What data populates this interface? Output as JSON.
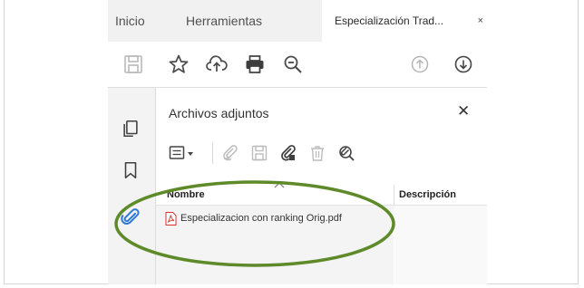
{
  "tabs": [
    {
      "label": "Inicio"
    },
    {
      "label": "Herramientas"
    },
    {
      "label": "Especialización Trad..."
    }
  ],
  "tab_close_symbol": "×",
  "toolbar": {
    "icons": [
      "save-icon",
      "bookmark-star-icon",
      "upload-cloud-icon",
      "print-icon",
      "zoom-out-icon",
      "page-up-icon",
      "page-down-icon"
    ]
  },
  "rail": {
    "icons": [
      "page-thumbnails-icon",
      "bookmark-icon",
      "attachment-paperclip-icon"
    ],
    "active": "attachment-paperclip-icon"
  },
  "panel": {
    "title": "Archivos adjuntos",
    "close_symbol": "✕",
    "tools": [
      "options-menu-icon",
      "add-attachment-icon",
      "save-attachment-icon",
      "open-attachment-icon",
      "delete-icon",
      "search-attachment-icon"
    ],
    "columns": {
      "name": "Nombre",
      "description": "Descripción"
    },
    "files": [
      {
        "name": "Especializacion con ranking Orig.pdf",
        "description": ""
      }
    ]
  },
  "colors": {
    "tabbar_bg": "#f1f1f1",
    "rail_bg": "#f3f3f3",
    "active_blue": "#2f7ad6",
    "pdf_red": "#d9342b",
    "highlight_green": "#5e8a2a"
  }
}
